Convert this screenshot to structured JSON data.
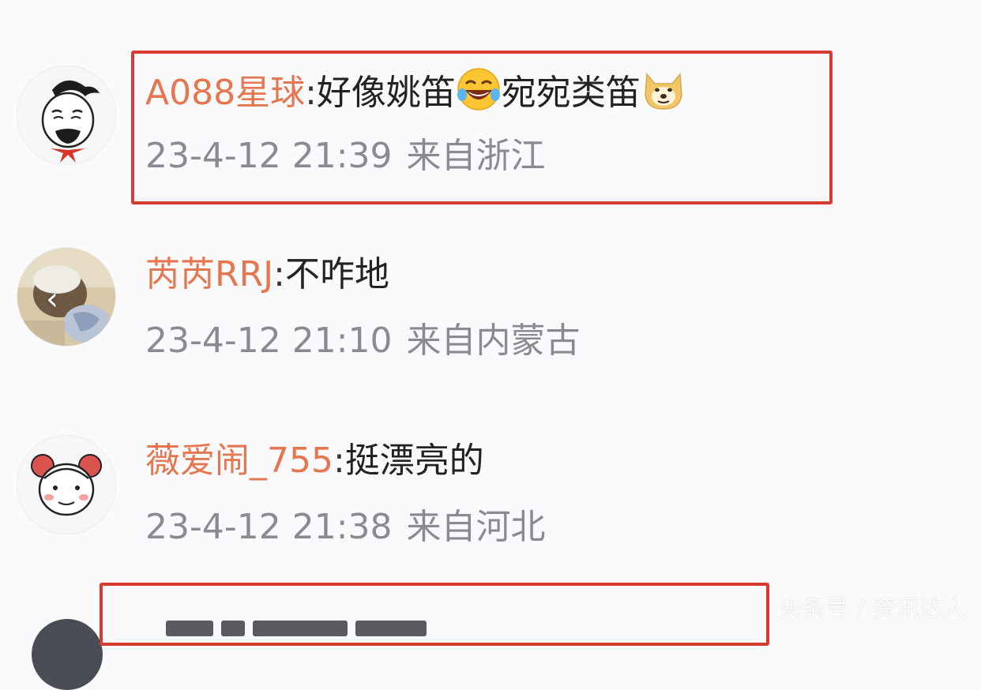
{
  "comments": [
    {
      "username": "A088星球",
      "separator": ":",
      "text_part1": "好像姚笛",
      "emoji1": "laughing-tears-emoji",
      "text_part2": "宛宛类笛",
      "emoji2": "doge-emoji",
      "time": "23-4-12 21:39",
      "location": "来自浙江",
      "avatar_icon": "ancient-scholar-avatar",
      "highlighted": true
    },
    {
      "username": "芮芮RRJ",
      "separator": ":",
      "text": "不咋地",
      "time": "23-4-12 21:10",
      "location": "来自内蒙古",
      "avatar_icon": "photo-avatar",
      "nav_arrow": "‹"
    },
    {
      "username": "薇爱闹_755",
      "separator": ":",
      "text": "挺漂亮的",
      "time": "23-4-12 21:38",
      "location": "来自河北",
      "avatar_icon": "cartoon-girl-avatar"
    }
  ],
  "watermark": "头条号 / 资讯达人",
  "colors": {
    "username": "#e5764f",
    "highlight": "#d63a30",
    "meta": "#8a8a92"
  }
}
